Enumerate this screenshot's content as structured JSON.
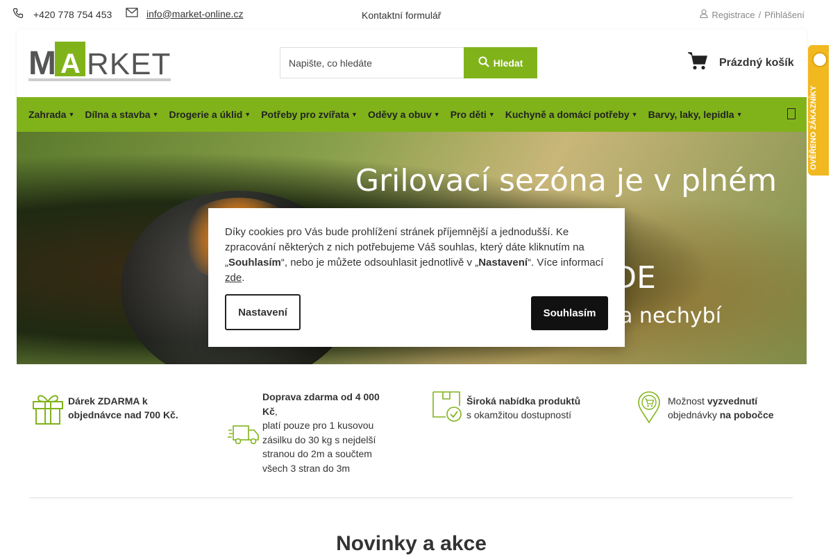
{
  "topbar": {
    "phone": "+420 778 754 453",
    "email": "info@market-online.cz",
    "contact_form": "Kontaktní formulář",
    "register": "Registrace",
    "separator": "/",
    "login": "Přihlášení"
  },
  "header": {
    "logo_text": "MARKET",
    "search_placeholder": "Napište, co hledáte",
    "search_button": "Hledat",
    "cart_label": "Prázdný košík"
  },
  "nav": {
    "items": [
      {
        "label": "Zahrada"
      },
      {
        "label": "Dílna a stavba"
      },
      {
        "label": "Drogerie a úklid"
      },
      {
        "label": "Potřeby pro zvířata"
      },
      {
        "label": "Oděvy a obuv"
      },
      {
        "label": "Pro děti"
      },
      {
        "label": "Kuchyně a domácí potřeby"
      },
      {
        "label": "Barvy, laky, lepidla"
      }
    ]
  },
  "banner": {
    "line1": "Grilovací sezóna je v plném",
    "line2": "si ZDE",
    "line3": "na nechybí"
  },
  "badge": {
    "text": "OVĚŘENO ZÁKAZNÍKY"
  },
  "features": {
    "gift": {
      "bold": "Dárek ZDARMA k objednávce nad 700 Kč."
    },
    "shipping": {
      "bold": "Doprava zdarma od 4 000 Kč",
      "comma": ",",
      "text": "platí pouze pro 1 kusovou zásilku do 30 kg s nejdelší stranou do 2m a součtem všech 3 stran do 3m"
    },
    "range": {
      "bold": "Široká nabídka produktů",
      "text": "s okamžitou dostupností"
    },
    "pickup": {
      "pre": "Možnost ",
      "bold1": "vyzvednutí",
      "mid": "objednávky ",
      "bold2": "na pobočce"
    }
  },
  "section_title": "Novinky a akce",
  "cookie": {
    "text1": "Díky cookies pro Vás bude prohlížení stránek příjemnější a jednodušší. Ke zpracování některých z nich potřebujeme Váš souhlas, který dáte kliknutím na „",
    "bold1": "Souhlasím",
    "text2": "“, nebo je můžete odsouhlasit jednotlivě v „",
    "bold2": "Nastavení",
    "text3": "“. Více informací ",
    "link": "zde",
    "text4": ".",
    "btn_settings": "Nastavení",
    "btn_agree": "Souhlasím"
  },
  "colors": {
    "brand_green": "#80b31a",
    "badge_yellow": "#f2b820"
  }
}
